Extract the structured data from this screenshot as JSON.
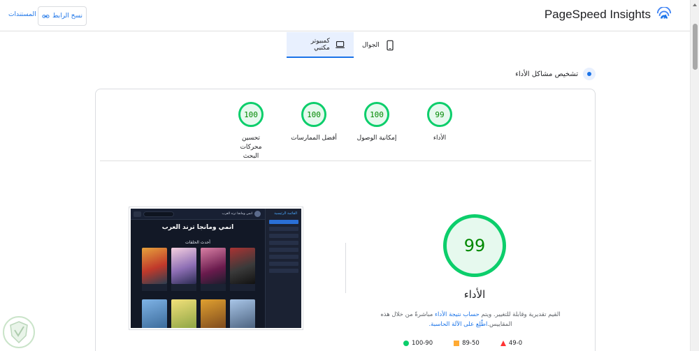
{
  "header": {
    "brand_title": "PageSpeed Insights",
    "copy_link_label": "نسخ الرابط",
    "docs_label": "المستندات"
  },
  "tabs": [
    {
      "label": "الجوال",
      "icon": "phone-icon",
      "active": false
    },
    {
      "label": "كمبيوتر مكتبي",
      "icon": "laptop-icon",
      "active": true
    }
  ],
  "diagnose": {
    "label": "تشخيص مشاكل الأداء"
  },
  "scores": [
    {
      "label": "الأداء",
      "value": "99"
    },
    {
      "label": "إمكانية الوصول",
      "value": "100"
    },
    {
      "label": "أفضل الممارسات",
      "value": "100"
    },
    {
      "label": "تحسين محركات البحث",
      "value": "100"
    }
  ],
  "performance": {
    "score": "99",
    "title": "الأداء",
    "desc_part1": "القيم تقديرية وقابلة للتغيير. ويتم ",
    "desc_link1": "حساب نتيجة الأداء",
    "desc_part2": " مباشرةً من خلال هذه المقاييس.",
    "desc_link2": "اطّلِع على الآلة الحاسبة."
  },
  "legend": [
    {
      "label": "49-0",
      "shape": "triangle",
      "color": "#ff3333"
    },
    {
      "label": "89-50",
      "shape": "square",
      "color": "#ffaa33"
    },
    {
      "label": "100-90",
      "shape": "circle",
      "color": "#0cce6b"
    }
  ],
  "screenshot": {
    "site_title": "انمي ومانجا ترند العرب",
    "hero_title": "انمي ومانجا ترند العرب",
    "section_title": "أحدث الحلقات",
    "sidebar_title": "القائمة الرئيسية"
  },
  "colors": {
    "accent": "#1a73e8",
    "pass": "#0cce6b",
    "pass_text": "#008800"
  }
}
